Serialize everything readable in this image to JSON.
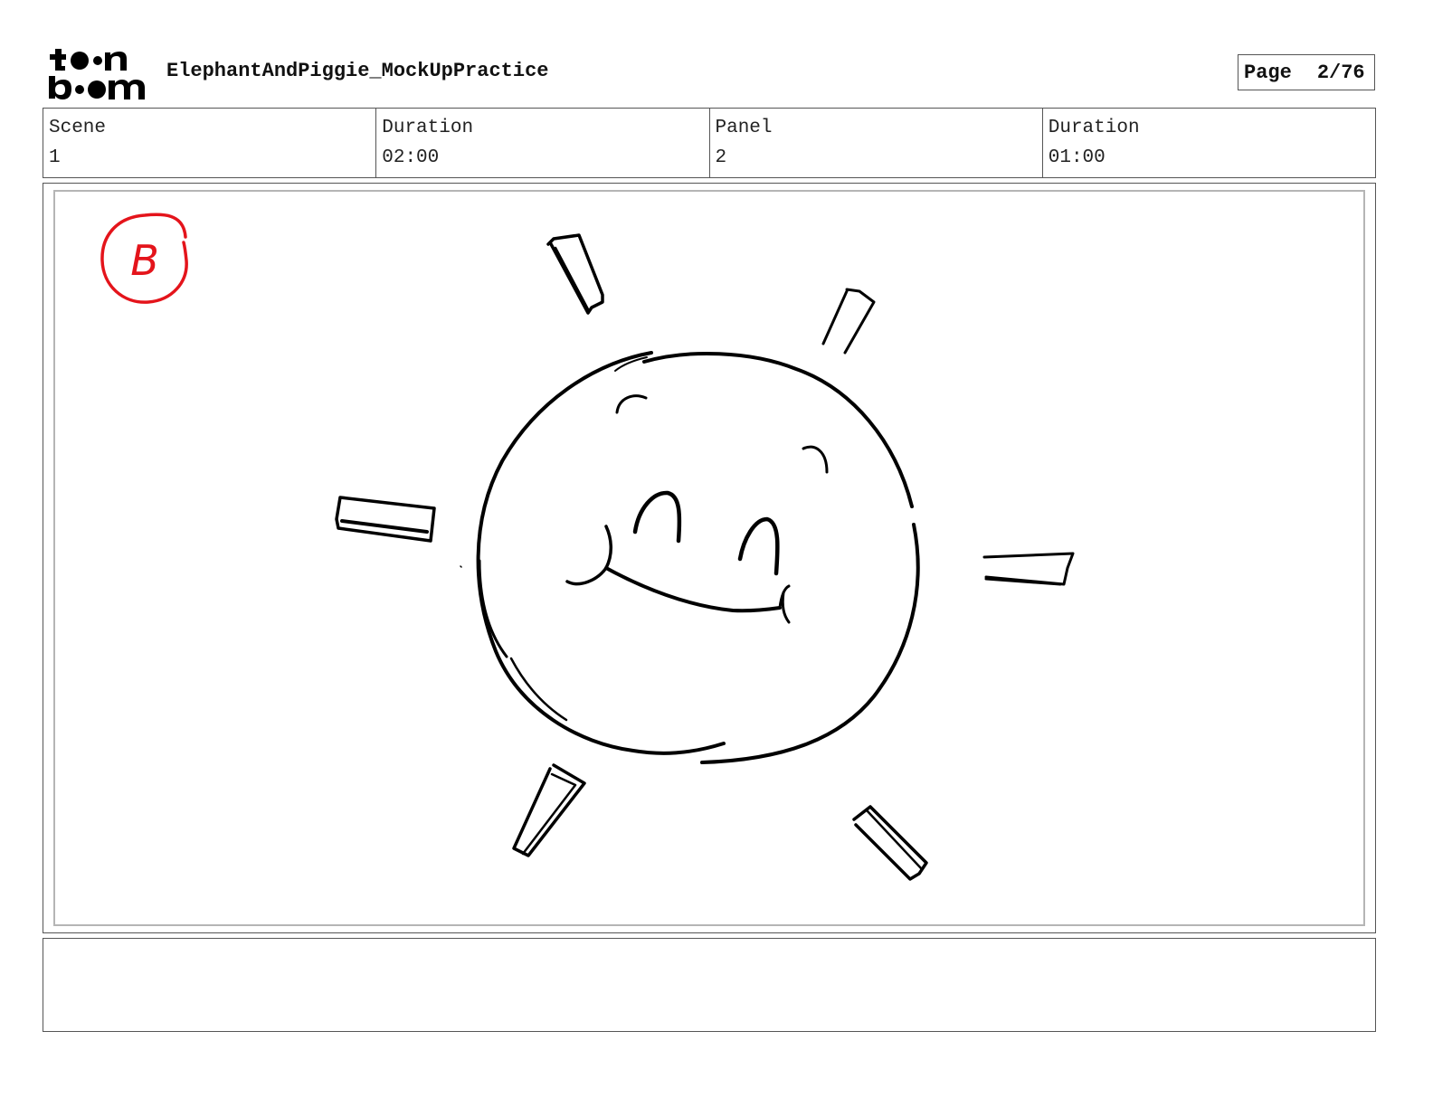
{
  "header": {
    "logo_text": "toon boom",
    "project_title": "ElephantAndPiggie_MockUpPractice",
    "page_label": "Page",
    "page_value": "2/76"
  },
  "info": [
    {
      "label": "Scene",
      "value": "1"
    },
    {
      "label": "Duration",
      "value": "02:00"
    },
    {
      "label": "Panel",
      "value": "2"
    },
    {
      "label": "Duration",
      "value": "01:00"
    }
  ],
  "panel": {
    "marker_letter": "B",
    "marker_color": "#e4141b",
    "drawing": "sun-sketch"
  },
  "notes": {
    "text": ""
  }
}
